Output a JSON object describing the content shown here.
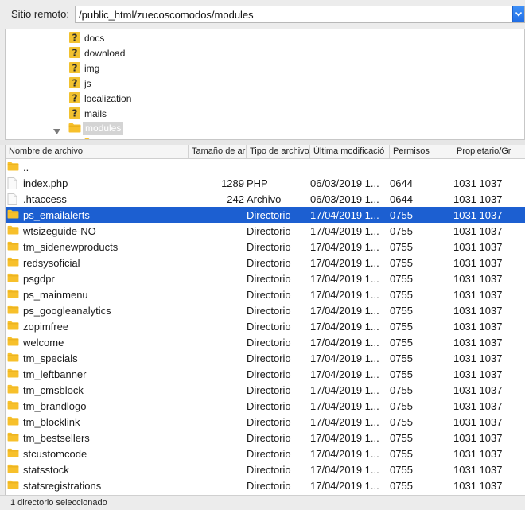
{
  "remote": {
    "label": "Sitio remoto:",
    "path": "/public_html/zuecoscomodos/modules"
  },
  "tree": {
    "items": [
      {
        "label": "docs",
        "icon": "unknown-folder-icon"
      },
      {
        "label": "download",
        "icon": "unknown-folder-icon"
      },
      {
        "label": "img",
        "icon": "unknown-folder-icon"
      },
      {
        "label": "js",
        "icon": "unknown-folder-icon"
      },
      {
        "label": "localization",
        "icon": "unknown-folder-icon"
      },
      {
        "label": "mails",
        "icon": "unknown-folder-icon"
      },
      {
        "label": "modules",
        "icon": "folder-icon",
        "expanded": true,
        "selected": true
      }
    ]
  },
  "columns": [
    "Nombre de archivo",
    "Tamaño de ar",
    "Tipo de archivo",
    "Última modificació",
    "Permisos",
    "Propietario/Gr"
  ],
  "files": [
    {
      "name": "..",
      "size": "",
      "type": "",
      "modified": "",
      "perms": "",
      "owner": "",
      "icon": "folder-icon"
    },
    {
      "name": "index.php",
      "size": "1289",
      "type": "PHP",
      "modified": "06/03/2019 1...",
      "perms": "0644",
      "owner": "1031 1037",
      "icon": "file-icon"
    },
    {
      "name": ".htaccess",
      "size": "242",
      "type": "Archivo",
      "modified": "06/03/2019 1...",
      "perms": "0644",
      "owner": "1031 1037",
      "icon": "file-icon"
    },
    {
      "name": "ps_emailalerts",
      "size": "",
      "type": "Directorio",
      "modified": "17/04/2019 1...",
      "perms": "0755",
      "owner": "1031 1037",
      "icon": "folder-icon",
      "selected": true
    },
    {
      "name": "wtsizeguide-NO",
      "size": "",
      "type": "Directorio",
      "modified": "17/04/2019 1...",
      "perms": "0755",
      "owner": "1031 1037",
      "icon": "folder-icon"
    },
    {
      "name": "tm_sidenewproducts",
      "size": "",
      "type": "Directorio",
      "modified": "17/04/2019 1...",
      "perms": "0755",
      "owner": "1031 1037",
      "icon": "folder-icon"
    },
    {
      "name": "redsysoficial",
      "size": "",
      "type": "Directorio",
      "modified": "17/04/2019 1...",
      "perms": "0755",
      "owner": "1031 1037",
      "icon": "folder-icon"
    },
    {
      "name": "psgdpr",
      "size": "",
      "type": "Directorio",
      "modified": "17/04/2019 1...",
      "perms": "0755",
      "owner": "1031 1037",
      "icon": "folder-icon"
    },
    {
      "name": "ps_mainmenu",
      "size": "",
      "type": "Directorio",
      "modified": "17/04/2019 1...",
      "perms": "0755",
      "owner": "1031 1037",
      "icon": "folder-icon"
    },
    {
      "name": "ps_googleanalytics",
      "size": "",
      "type": "Directorio",
      "modified": "17/04/2019 1...",
      "perms": "0755",
      "owner": "1031 1037",
      "icon": "folder-icon"
    },
    {
      "name": "zopimfree",
      "size": "",
      "type": "Directorio",
      "modified": "17/04/2019 1...",
      "perms": "0755",
      "owner": "1031 1037",
      "icon": "folder-icon"
    },
    {
      "name": "welcome",
      "size": "",
      "type": "Directorio",
      "modified": "17/04/2019 1...",
      "perms": "0755",
      "owner": "1031 1037",
      "icon": "folder-icon"
    },
    {
      "name": "tm_specials",
      "size": "",
      "type": "Directorio",
      "modified": "17/04/2019 1...",
      "perms": "0755",
      "owner": "1031 1037",
      "icon": "folder-icon"
    },
    {
      "name": "tm_leftbanner",
      "size": "",
      "type": "Directorio",
      "modified": "17/04/2019 1...",
      "perms": "0755",
      "owner": "1031 1037",
      "icon": "folder-icon"
    },
    {
      "name": "tm_cmsblock",
      "size": "",
      "type": "Directorio",
      "modified": "17/04/2019 1...",
      "perms": "0755",
      "owner": "1031 1037",
      "icon": "folder-icon"
    },
    {
      "name": "tm_brandlogo",
      "size": "",
      "type": "Directorio",
      "modified": "17/04/2019 1...",
      "perms": "0755",
      "owner": "1031 1037",
      "icon": "folder-icon"
    },
    {
      "name": "tm_blocklink",
      "size": "",
      "type": "Directorio",
      "modified": "17/04/2019 1...",
      "perms": "0755",
      "owner": "1031 1037",
      "icon": "folder-icon"
    },
    {
      "name": "tm_bestsellers",
      "size": "",
      "type": "Directorio",
      "modified": "17/04/2019 1...",
      "perms": "0755",
      "owner": "1031 1037",
      "icon": "folder-icon"
    },
    {
      "name": "stcustomcode",
      "size": "",
      "type": "Directorio",
      "modified": "17/04/2019 1...",
      "perms": "0755",
      "owner": "1031 1037",
      "icon": "folder-icon"
    },
    {
      "name": "statsstock",
      "size": "",
      "type": "Directorio",
      "modified": "17/04/2019 1...",
      "perms": "0755",
      "owner": "1031 1037",
      "icon": "folder-icon"
    },
    {
      "name": "statsregistrations",
      "size": "",
      "type": "Directorio",
      "modified": "17/04/2019 1...",
      "perms": "0755",
      "owner": "1031 1037",
      "icon": "folder-icon"
    }
  ],
  "status": {
    "text": "1 directorio seleccionado"
  },
  "colors": {
    "selection": "#1c5fd1",
    "folder": "#f7c02b",
    "unknown": "#f2c230"
  }
}
